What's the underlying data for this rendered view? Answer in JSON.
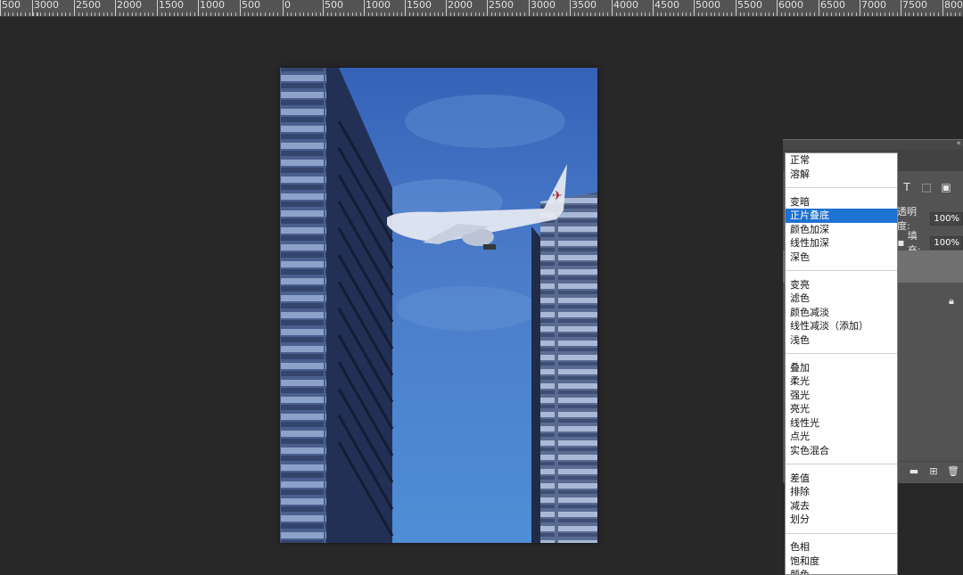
{
  "ruler": {
    "ticks": [
      "500",
      "3000",
      "2500",
      "2000",
      "1500",
      "1000",
      "500",
      "0",
      "500",
      "1000",
      "1500",
      "2000",
      "2500",
      "3000",
      "3500",
      "4000",
      "4500",
      "5000",
      "5500",
      "6000",
      "6500",
      "7000",
      "7500",
      "8000"
    ]
  },
  "panel": {
    "opacity_label": "透明度:",
    "opacity_value": "100%",
    "fill_label": "填充:",
    "fill_value": "100%"
  },
  "blend_menu": {
    "groups": [
      [
        "正常",
        "溶解"
      ],
      [
        "变暗",
        "正片叠底",
        "颜色加深",
        "线性加深",
        "深色"
      ],
      [
        "变亮",
        "滤色",
        "颜色减淡",
        "线性减淡（添加）",
        "浅色"
      ],
      [
        "叠加",
        "柔光",
        "强光",
        "亮光",
        "线性光",
        "点光",
        "实色混合"
      ],
      [
        "差值",
        "排除",
        "减去",
        "划分"
      ],
      [
        "色相",
        "饱和度",
        "颜色"
      ]
    ],
    "selected": "正片叠底"
  },
  "colors": {
    "selection": "#1e72d1",
    "workspace": "#282828",
    "panel": "#535353"
  }
}
